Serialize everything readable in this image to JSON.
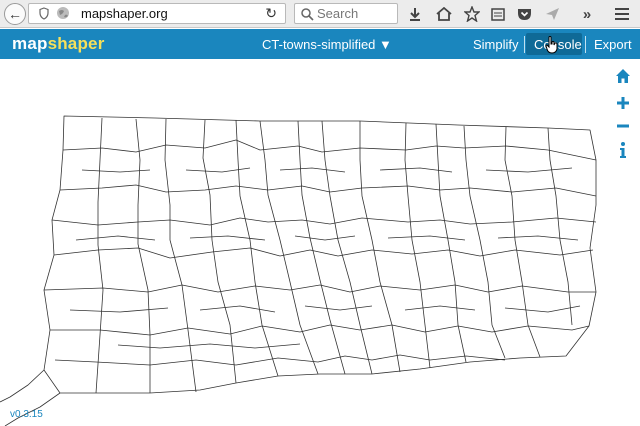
{
  "browser": {
    "url": "mapshaper.org",
    "search_placeholder": "Search",
    "icons": [
      "back-icon",
      "shield-icon",
      "globe-icon",
      "reload-icon",
      "search-icon",
      "download-icon",
      "home-icon",
      "star-icon",
      "reading-list-icon",
      "pocket-icon",
      "send-icon",
      "overflow-icon",
      "hamburger-menu-icon"
    ]
  },
  "app": {
    "logo_part1": "map",
    "logo_part2": "shaper",
    "layer_name": "CT-towns-simplified ▼",
    "menu": {
      "simplify": "Simplify",
      "console": "Console",
      "export": "Export"
    },
    "version": "v0.3.15",
    "colors": {
      "header_bg": "#1a86be",
      "logo_accent": "#f6e05b",
      "console_active_bg": "#0f6a97",
      "side_icon": "#1a86be"
    },
    "side_buttons": [
      "home-icon",
      "zoom-in-icon",
      "zoom-out-icon",
      "info-icon"
    ]
  }
}
